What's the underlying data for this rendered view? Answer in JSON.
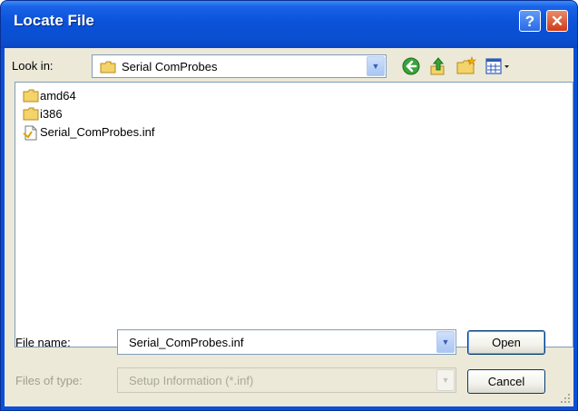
{
  "window": {
    "title": "Locate File",
    "help_glyph": "?",
    "close_glyph": "✕"
  },
  "toolbar": {
    "look_in_label": "Look in:",
    "look_in_value": "Serial ComProbes",
    "icons": [
      "back-icon",
      "up-folder-icon",
      "new-folder-icon",
      "views-menu-icon"
    ]
  },
  "files": [
    {
      "name": "amd64",
      "type": "folder"
    },
    {
      "name": "i386",
      "type": "folder"
    },
    {
      "name": "Serial_ComProbes.inf",
      "type": "inf-file"
    }
  ],
  "form": {
    "file_name_label": "File name:",
    "file_name_value": "Serial_ComProbes.inf",
    "file_type_label": "Files of type:",
    "file_type_value": "Setup Information (*.inf)"
  },
  "buttons": {
    "open": "Open",
    "cancel": "Cancel"
  },
  "colors": {
    "title_bar": "#0a4fd8",
    "dialog_bg": "#ece9d8",
    "folder": "#f3d36a"
  }
}
